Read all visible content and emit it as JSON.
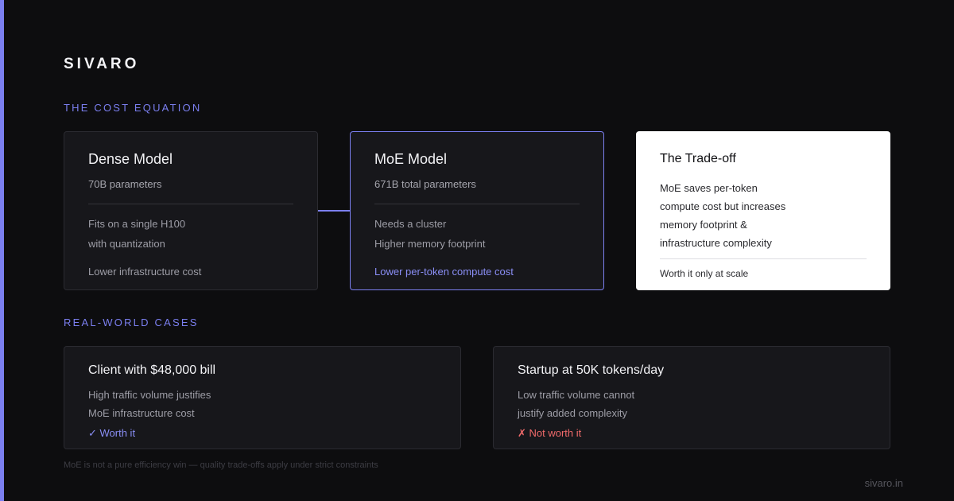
{
  "brand": "SIVARO",
  "sections": {
    "cost_equation": "THE COST EQUATION",
    "real_world": "REAL-WORLD CASES"
  },
  "dense": {
    "title": "Dense Model",
    "params": "70B parameters",
    "line1": "Fits on a single H100",
    "line2": "with quantization",
    "line3": "Lower infrastructure cost"
  },
  "moe": {
    "title": "MoE Model",
    "params": "671B total parameters",
    "line1": "Needs a cluster",
    "line2": "Higher memory footprint",
    "line3": "Lower per-token compute cost"
  },
  "tradeoff": {
    "title": "The Trade-off",
    "lines": [
      "MoE saves per-token",
      "compute cost but increases",
      "memory footprint &",
      "infrastructure complexity"
    ],
    "verdict": "Worth it only at scale"
  },
  "cases": [
    {
      "title": "Client with $48,000 bill",
      "line1": "High traffic volume justifies",
      "line2": "MoE infrastructure cost",
      "verdict": "✓ Worth it"
    },
    {
      "title": "Startup at 50K tokens/day",
      "line1": "Low traffic volume cannot",
      "line2": "justify added complexity",
      "verdict": "✗ Not worth it"
    }
  ],
  "footnote": "MoE is not a pure efficiency win — quality trade-offs apply under strict constraints",
  "site": "sivaro.in",
  "colors": {
    "accent": "#7b7ff0",
    "bad": "#f06a6a",
    "background": "#0d0d0f"
  }
}
